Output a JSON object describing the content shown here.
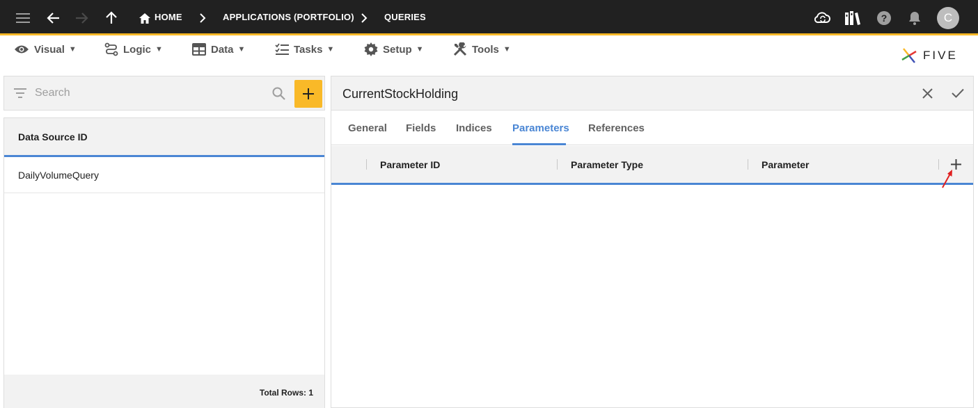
{
  "topbar": {
    "breadcrumbs": [
      "HOME",
      "APPLICATIONS (PORTFOLIO)",
      "QUERIES"
    ],
    "avatar_initial": "C",
    "icons": [
      "menu-icon",
      "back-arrow-icon",
      "forward-arrow-icon",
      "up-arrow-icon",
      "home-icon",
      "chevron-right-icon",
      "cloud-sync-icon",
      "library-icon",
      "help-icon",
      "bell-icon"
    ]
  },
  "menubar": {
    "items": [
      {
        "label": "Visual",
        "icon": "eye-icon"
      },
      {
        "label": "Logic",
        "icon": "flow-icon"
      },
      {
        "label": "Data",
        "icon": "table-icon"
      },
      {
        "label": "Tasks",
        "icon": "checklist-icon"
      },
      {
        "label": "Setup",
        "icon": "gear-icon"
      },
      {
        "label": "Tools",
        "icon": "tools-icon"
      }
    ],
    "logo_text": "FIVE"
  },
  "left": {
    "search_placeholder": "Search",
    "column_header": "Data Source ID",
    "rows": [
      "DailyVolumeQuery"
    ],
    "footer": "Total Rows: 1"
  },
  "form": {
    "title": "CurrentStockHolding",
    "tabs": [
      "General",
      "Fields",
      "Indices",
      "Parameters",
      "References"
    ],
    "active_tab": "Parameters",
    "columns": [
      "Parameter ID",
      "Parameter Type",
      "Parameter"
    ]
  },
  "colors": {
    "topbar": "#212121",
    "accent": "#f9b928",
    "active": "#4a86d4",
    "arrow": "#e02020"
  }
}
